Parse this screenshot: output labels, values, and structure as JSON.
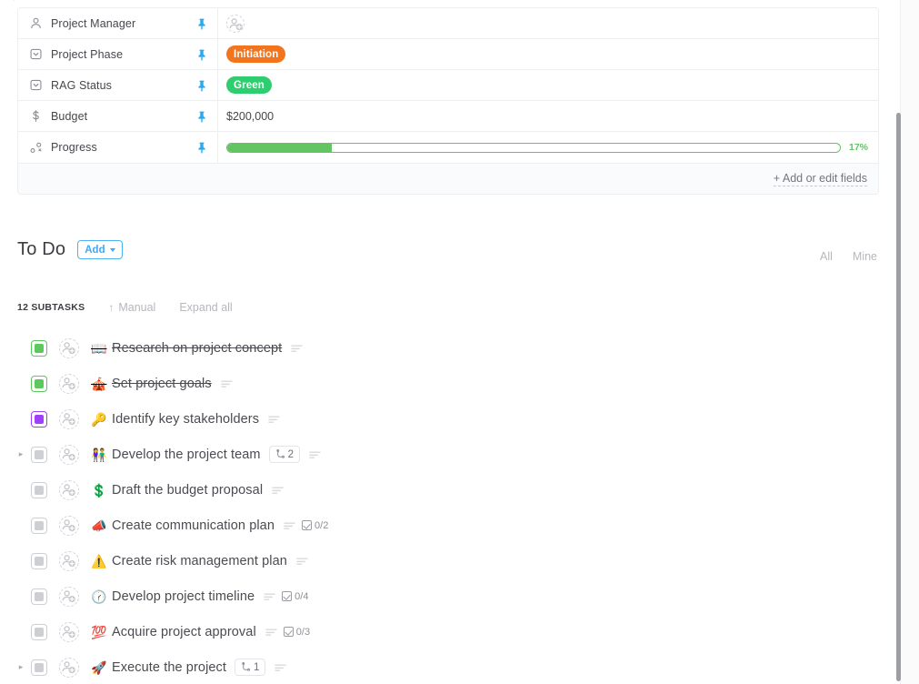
{
  "properties": {
    "add_fields_label": "+ Add or edit fields",
    "rows": [
      {
        "icon": "person-icon",
        "label": "Project Manager",
        "type": "avatar",
        "value": "",
        "pin": "pin-icon"
      },
      {
        "icon": "dropdown-field-icon",
        "label": "Project Phase",
        "type": "tag",
        "value": "Initiation",
        "color": "#f2751e",
        "pin": "pin-icon"
      },
      {
        "icon": "dropdown-field-icon",
        "label": "RAG Status",
        "type": "tag",
        "value": "Green",
        "color": "#2ecd6f",
        "pin": "pin-icon"
      },
      {
        "icon": "dollar-icon",
        "label": "Budget",
        "type": "text",
        "value": "$200,000",
        "pin": "pin-icon"
      },
      {
        "icon": "progress-icon",
        "label": "Progress",
        "type": "progress",
        "value": "17%",
        "percent": 17,
        "color": "#62c462",
        "pin": "pin-icon"
      }
    ]
  },
  "todo": {
    "title": "To Do",
    "add_label": "Add",
    "filters": [
      {
        "label": "All"
      },
      {
        "label": "Mine"
      }
    ]
  },
  "subtasks_toolbar": {
    "count_label": "12 SUBTASKS",
    "sort_label": "Manual",
    "sort_arrow": "↑",
    "expand_label": "Expand all"
  },
  "tasks": [
    {
      "name": "Research on project concept",
      "emoji": "📖",
      "status_color": "#5dc85d",
      "done": true,
      "expandable": false,
      "has_description": true,
      "subtask_count": null,
      "checklist": null
    },
    {
      "name": "Set project goals",
      "emoji": "🎪",
      "status_color": "#5dc85d",
      "done": true,
      "expandable": false,
      "has_description": true,
      "subtask_count": null,
      "checklist": null
    },
    {
      "name": "Identify key stakeholders",
      "emoji": "🔑",
      "status_color": "#a03ffb",
      "done": false,
      "expandable": false,
      "has_description": true,
      "subtask_count": null,
      "checklist": null
    },
    {
      "name": "Develop the project team",
      "emoji": "👫",
      "status_color": "#c6c7cc",
      "done": false,
      "expandable": true,
      "has_description": true,
      "subtask_count": "2",
      "checklist": null
    },
    {
      "name": "Draft the budget proposal",
      "emoji": "💲",
      "status_color": "#c6c7cc",
      "done": false,
      "expandable": false,
      "has_description": true,
      "subtask_count": null,
      "checklist": null
    },
    {
      "name": "Create communication plan",
      "emoji": "📣",
      "status_color": "#c6c7cc",
      "done": false,
      "expandable": false,
      "has_description": true,
      "subtask_count": null,
      "checklist": "0/2"
    },
    {
      "name": "Create risk management plan",
      "emoji": "⚠️",
      "status_color": "#c6c7cc",
      "done": false,
      "expandable": false,
      "has_description": true,
      "subtask_count": null,
      "checklist": null
    },
    {
      "name": "Develop project timeline",
      "emoji": "🕜",
      "status_color": "#c6c7cc",
      "done": false,
      "expandable": false,
      "has_description": true,
      "subtask_count": null,
      "checklist": "0/4"
    },
    {
      "name": "Acquire project approval",
      "emoji": "💯",
      "status_color": "#c6c7cc",
      "done": false,
      "expandable": false,
      "has_description": true,
      "subtask_count": null,
      "checklist": "0/3"
    },
    {
      "name": "Execute the project",
      "emoji": "🚀",
      "status_color": "#c6c7cc",
      "done": false,
      "expandable": true,
      "has_description": true,
      "subtask_count": "1",
      "checklist": null
    }
  ]
}
